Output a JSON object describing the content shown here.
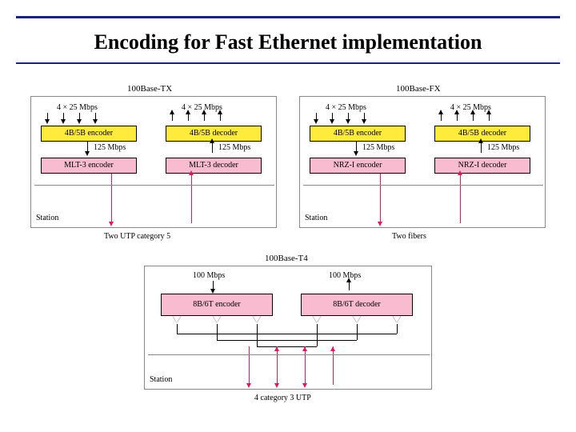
{
  "title": "Encoding for Fast Ethernet implementation",
  "panels": {
    "tx": {
      "name": "100Base-TX",
      "rate_top": "4 × 25 Mbps",
      "encoder_top": "4B/5B encoder",
      "decoder_top": "4B/5B decoder",
      "rate_mid": "125 Mbps",
      "encoder_bot": "MLT-3 encoder",
      "decoder_bot": "MLT-3 decoder",
      "station": "Station",
      "medium": "Two UTP category 5"
    },
    "fx": {
      "name": "100Base-FX",
      "rate_top": "4 × 25 Mbps",
      "encoder_top": "4B/5B encoder",
      "decoder_top": "4B/5B decoder",
      "rate_mid": "125 Mbps",
      "encoder_bot": "NRZ-I encoder",
      "decoder_bot": "NRZ-I decoder",
      "station": "Station",
      "medium": "Two fibers"
    },
    "t4": {
      "name": "100Base-T4",
      "rate_top": "100 Mbps",
      "encoder": "8B/6T encoder",
      "decoder": "8B/6T decoder",
      "station": "Station",
      "medium": "4 category 3 UTP"
    }
  }
}
